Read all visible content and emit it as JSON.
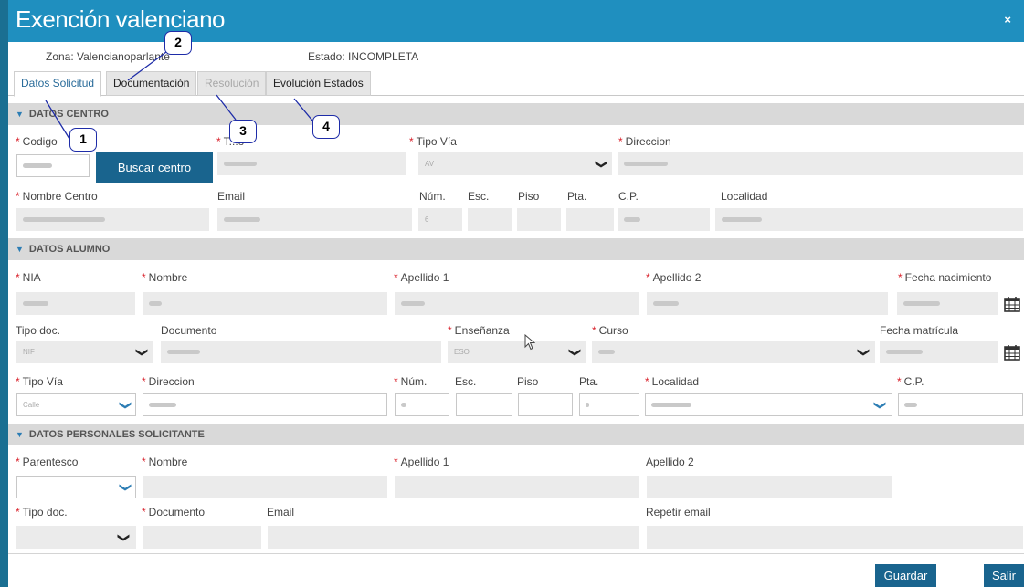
{
  "window": {
    "title": "Exención valenciano",
    "close_icon": "×"
  },
  "info": {
    "zona": "Zona: Valencianoparlante",
    "estado": "Estado: INCOMPLETA"
  },
  "tabs": [
    {
      "label": "Datos Solicitud",
      "state": "active"
    },
    {
      "label": "Documentación",
      "state": "normal"
    },
    {
      "label": "Resolución",
      "state": "disabled"
    },
    {
      "label": "Evolución Estados",
      "state": "normal"
    }
  ],
  "callouts": [
    "1",
    "2",
    "3",
    "4"
  ],
  "centro": {
    "section_title": "DATOS CENTRO",
    "codigo_label": "Codigo",
    "tipo_label": "T...o",
    "tipo_via_label": "Tipo Vía",
    "tipo_via_value": "AV",
    "direccion_label": "Direccion",
    "buscar_label": "Buscar centro",
    "nombre_label": "Nombre Centro",
    "email_label": "Email",
    "num_label": "Núm.",
    "num_value": "6",
    "esc_label": "Esc.",
    "piso_label": "Piso",
    "pta_label": "Pta.",
    "cp_label": "C.P.",
    "localidad_label": "Localidad"
  },
  "alumno": {
    "section_title": "DATOS ALUMNO",
    "nia_label": "NIA",
    "nombre_label": "Nombre",
    "apellido1_label": "Apellido 1",
    "apellido2_label": "Apellido 2",
    "fecha_nac_label": "Fecha nacimiento",
    "tipo_doc_label": "Tipo doc.",
    "tipo_doc_value": "NIF",
    "documento_label": "Documento",
    "ensenanza_label": "Enseñanza",
    "ensenanza_value": "ESO",
    "curso_label": "Curso",
    "fecha_mat_label": "Fecha matrícula",
    "tipo_via_label": "Tipo Vía",
    "tipo_via_value": "Calle",
    "direccion_label": "Direccion",
    "num_label": "Núm.",
    "esc_label": "Esc.",
    "piso_label": "Piso",
    "pta_label": "Pta.",
    "localidad_label": "Localidad",
    "cp_label": "C.P."
  },
  "solicitante": {
    "section_title": "DATOS PERSONALES SOLICITANTE",
    "parentesco_label": "Parentesco",
    "nombre_label": "Nombre",
    "apellido1_label": "Apellido 1",
    "apellido2_label": "Apellido 2",
    "tipo_doc_label": "Tipo doc.",
    "documento_label": "Documento",
    "email_label": "Email",
    "repetir_email_label": "Repetir email"
  },
  "footer": {
    "guardar": "Guardar",
    "salir": "Salir"
  },
  "colors": {
    "titlebar": "#1f8fbf",
    "button": "#19648e",
    "required": "#d9232d",
    "callout": "#1e2ca8"
  },
  "icons": [
    "close-icon",
    "chevron-down-icon",
    "calendar-icon",
    "mouse-cursor-icon"
  ]
}
